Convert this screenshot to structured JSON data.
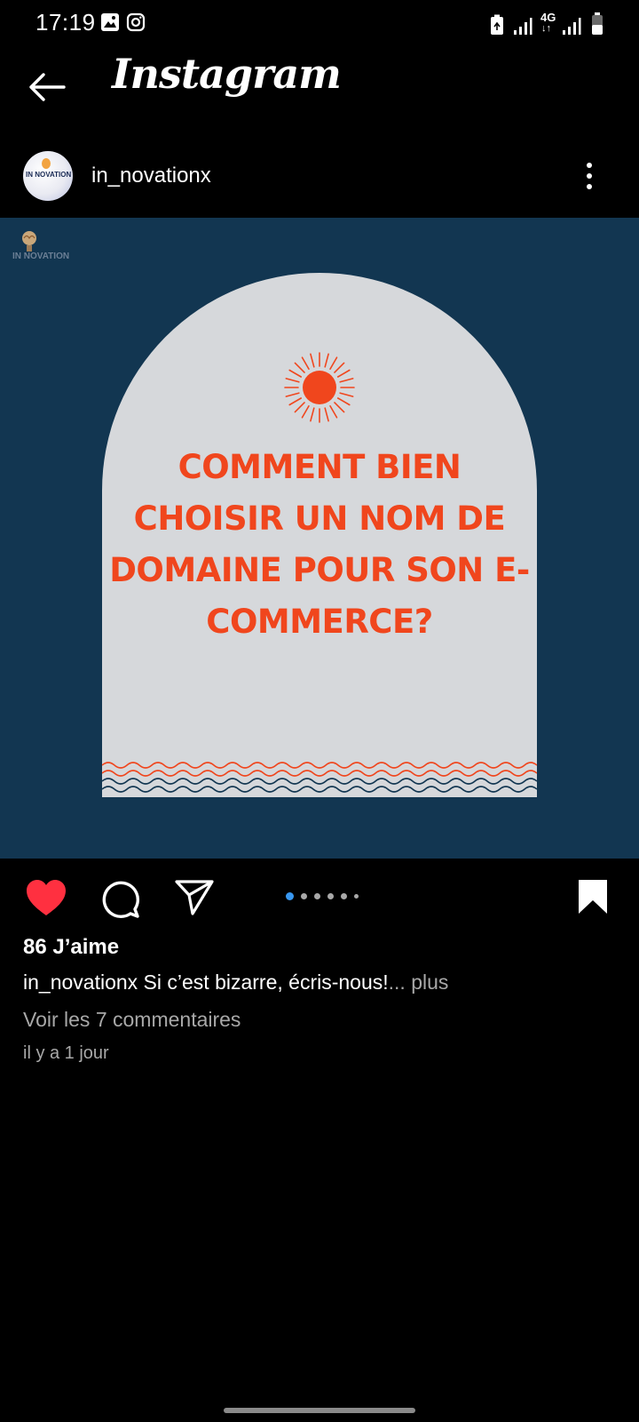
{
  "status_bar": {
    "time": "17:19",
    "network": "4G",
    "icons": [
      "gallery-icon",
      "instagram-icon",
      "battery-saver-icon",
      "signal-icon",
      "4g-signal-icon",
      "battery-icon"
    ]
  },
  "header": {
    "title": "Instagram",
    "back_icon": "arrow-left-icon"
  },
  "post": {
    "username": "in_novationx",
    "avatar_text": "IN NOVATION",
    "brand_logo_text": "IN NOVATION",
    "headline": "COMMENT BIEN CHOISIR UN NOM DE DOMAINE POUR SON E-COMMERCE?",
    "carousel": {
      "count": 6,
      "active_index": 0
    },
    "liked": true
  },
  "engagement": {
    "likes": "86 J’aime",
    "caption_user": "in_novationx",
    "caption_text": " Si c’est bizarre, écris-nous!",
    "caption_more": "... plus",
    "view_comments": "Voir les 7 commentaires",
    "timestamp": "il y a 1 jour"
  },
  "colors": {
    "background": "#000000",
    "post_bg": "#123651",
    "arch": "#d6d8db",
    "headline": "#f0461d",
    "like": "#ff3040",
    "carousel_active": "#3897f0"
  }
}
